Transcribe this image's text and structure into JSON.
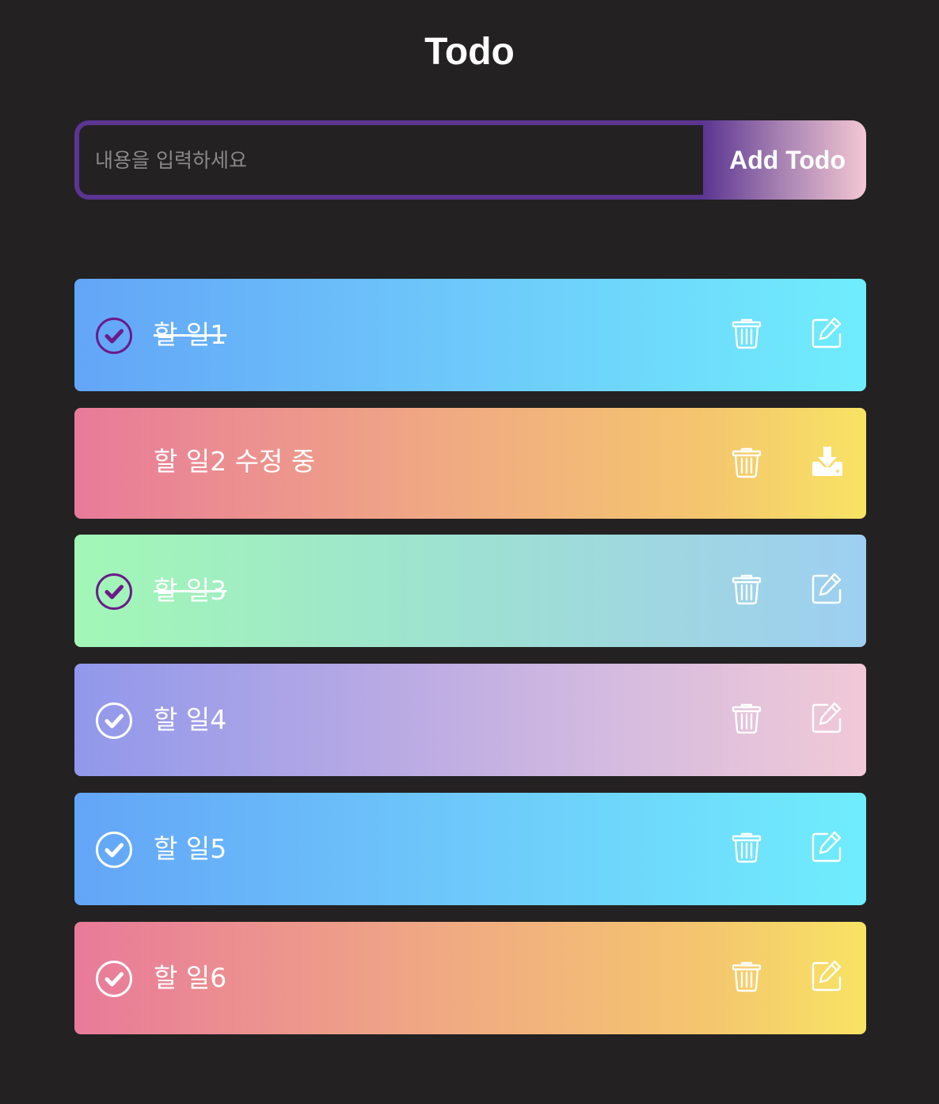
{
  "header": {
    "title": "Todo"
  },
  "form": {
    "placeholder": "내용을 입력하세요",
    "value": "",
    "add_label": "Add Todo"
  },
  "colors": {
    "background": "#232122",
    "accent": "#5b3591",
    "check_done": "#6b1a8a",
    "icon": "#ffffff"
  },
  "todos": [
    {
      "text": "할 일1",
      "completed": true,
      "editing": false,
      "theme": "blue"
    },
    {
      "text": "할 일2 수정 중",
      "completed": false,
      "editing": true,
      "theme": "peach"
    },
    {
      "text": "할 일3",
      "completed": true,
      "editing": false,
      "theme": "green"
    },
    {
      "text": "할 일4",
      "completed": false,
      "editing": false,
      "theme": "purple"
    },
    {
      "text": "할 일5",
      "completed": false,
      "editing": false,
      "theme": "blue"
    },
    {
      "text": "할 일6",
      "completed": false,
      "editing": false,
      "theme": "peach"
    }
  ],
  "icons": {
    "check": "check-circle-icon",
    "delete": "trash-icon",
    "edit": "pencil-square-icon",
    "save": "download-tray-icon"
  }
}
